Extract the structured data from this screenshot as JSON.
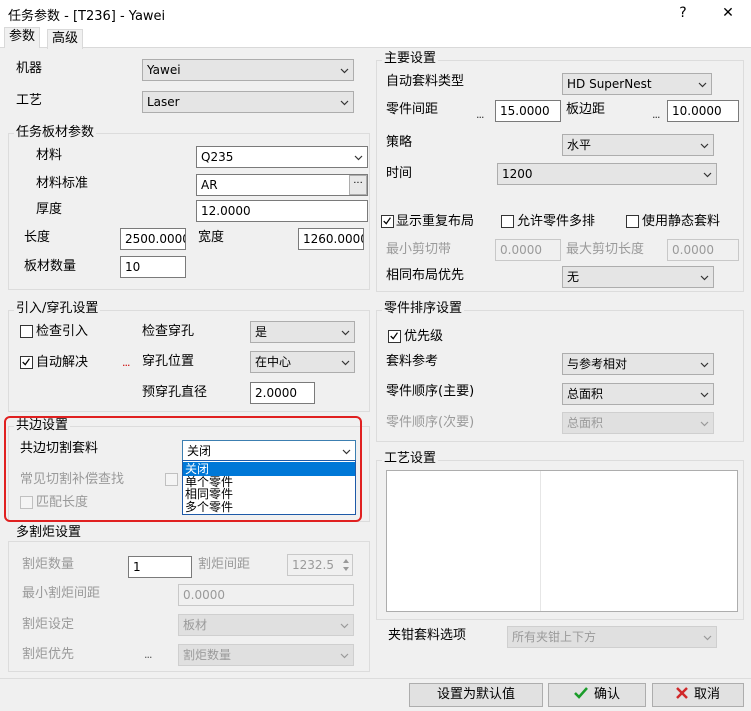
{
  "window": {
    "title": "任务参数 - [T236] - Yawei",
    "help_glyph": "?",
    "close_glyph": "✕"
  },
  "tabs": [
    "参数",
    "高级"
  ],
  "machine": {
    "label": "机器",
    "value": "Yawei"
  },
  "process": {
    "label": "工艺",
    "value": "Laser"
  },
  "sheet_params": {
    "title": "任务板材参数",
    "material_label": "材料",
    "material_value": "Q235",
    "material_std_label": "材料标准",
    "material_std_value": "AR",
    "thickness_label": "厚度",
    "thickness_value": "12.0000",
    "length_label": "长度",
    "length_value": "2500.0000",
    "width_label": "宽度",
    "width_value": "1260.0000",
    "count_label": "板材数量",
    "count_value": "10"
  },
  "leadin": {
    "title": "引入/穿孔设置",
    "check_leadin_label": "检查引入",
    "check_pierce_label": "检查穿孔",
    "check_pierce_value": "是",
    "auto_resolve_label": "自动解决",
    "pierce_pos_label": "穿孔位置",
    "pierce_pos_value": "在中心",
    "prepierce_label": "预穿孔直径",
    "prepierce_value": "2.0000"
  },
  "common_edge": {
    "title": "共边设置",
    "cut_nest_label": "共边切割套料",
    "cut_nest_value": "关闭",
    "common_cut_comp_label": "常见切割补偿查找",
    "match_length_label": "匹配长度",
    "options": [
      "关闭",
      "单个零件",
      "相同零件",
      "多个零件"
    ]
  },
  "multi_torch": {
    "title": "多割炬设置",
    "count_label": "割炬数量",
    "count_value": "1",
    "spacing_label": "割炬间距",
    "spacing_value": "1232.5",
    "min_spacing_label": "最小割炬间距",
    "min_spacing_value": "0.0000",
    "setting_label": "割炬设定",
    "setting_value": "板材",
    "priority_label": "割炬优先",
    "priority_value": "割炬数量"
  },
  "main_settings": {
    "title": "主要设置",
    "auto_nest_type_label": "自动套料类型",
    "auto_nest_type_value": "HD SuperNest",
    "part_gap_label": "零件间距",
    "part_gap_value": "15.0000",
    "plate_margin_label": "板边距",
    "plate_margin_value": "10.0000",
    "strategy_label": "策略",
    "strategy_value": "水平",
    "time_label": "时间",
    "time_value": "1200",
    "show_repeat_label": "显示重复布局",
    "allow_multi_label": "允许零件多排",
    "use_static_label": "使用静态套料",
    "min_strip_label": "最小剪切带",
    "min_strip_value": "0.0000",
    "max_cut_label": "最大剪切长度",
    "max_cut_value": "0.0000",
    "same_layout_label": "相同布局优先",
    "same_layout_value": "无"
  },
  "part_sort": {
    "title": "零件排序设置",
    "priority_label": "优先级",
    "nest_ref_label": "套料参考",
    "nest_ref_value": "与参考相对",
    "order_main_label": "零件顺序(主要)",
    "order_main_value": "总面积",
    "order_sec_label": "零件顺序(次要)",
    "order_sec_value": "总面积"
  },
  "process_settings": {
    "title": "工艺设置"
  },
  "clamp": {
    "label": "夹钳套料选项",
    "value": "所有夹钳上下方"
  },
  "buttons": {
    "default": "设置为默认值",
    "ok": "确认",
    "cancel": "取消"
  },
  "colors": {
    "highlight": "#e02020",
    "selection": "#0078d7",
    "ok_icon": "#1a9c2a",
    "cancel_icon": "#d0282a"
  }
}
